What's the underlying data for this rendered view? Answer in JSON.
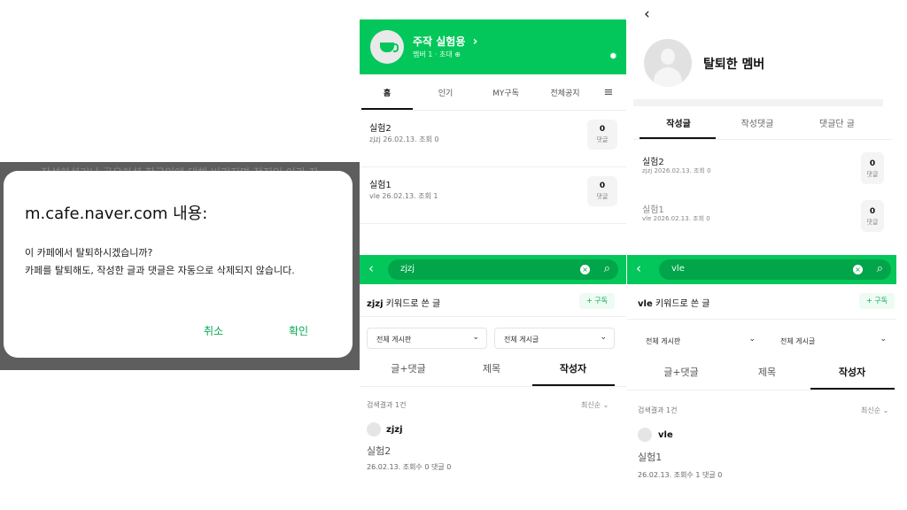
{
  "dialog": {
    "ghost_text": "작성하셨거나 공유하셨 한국인에 대해 버리지면 정진인 이라 자",
    "title": "m.cafe.naver.com 내용:",
    "line1": "이 카페에서 탈퇴하시겠습니까?",
    "line2": "카페를 탈퇴해도, 작성한 글과 댓글은 자동으로 삭제되지 않습니다.",
    "cancel": "취소",
    "confirm": "확인"
  },
  "cafe": {
    "name": "주작 실험용",
    "chevron": "›",
    "sub": "멤버 1 · 초대",
    "sub_icon": "⊕",
    "gear": "✹",
    "tabs": [
      "홈",
      "인기",
      "MY구독",
      "전체공지"
    ],
    "menu_icon": "≡",
    "posts": [
      {
        "title": "실험2",
        "meta": "zjzj  26.02.13.  조회 0",
        "count": "0",
        "label": "댓글"
      },
      {
        "title": "실험1",
        "meta": "vle  26.02.13.  조회 1",
        "count": "0",
        "label": "댓글"
      }
    ]
  },
  "search1": {
    "back": "‹",
    "query": "zjzj",
    "clear": "×",
    "search_icon": "⌕",
    "keyword": "zjzj",
    "keyword_suffix": " 키워드로 쓴 글",
    "subscribe": "+ 구독",
    "dropdown1": "전체 게시판",
    "dropdown2": "전체 게시글",
    "chev": "⌄",
    "tabs": [
      "글+댓글",
      "제목",
      "작성자"
    ],
    "result_count": "검색결과 1건",
    "sort": "최신순 ⌄",
    "author": "zjzj",
    "title": "실험2",
    "meta": "26.02.13.  조회수 0  댓글 0"
  },
  "search2": {
    "back": "‹",
    "query": "vle",
    "clear": "×",
    "search_icon": "⌕",
    "keyword": "vle",
    "keyword_suffix": " 키워드로 쓴 글",
    "subscribe": "+ 구독",
    "dropdown1": "전체 게시판",
    "dropdown2": "전체 게시글",
    "chev": "⌄",
    "tabs": [
      "글+댓글",
      "제목",
      "작성자"
    ],
    "result_count": "검색결과 1건",
    "sort": "최신순 ⌄",
    "author": "vle",
    "title": "실험1",
    "meta": "26.02.13.  조회수 1  댓글 0"
  },
  "member": {
    "back": "‹",
    "name": "탈퇴한 멤버",
    "tabs": [
      "작성글",
      "작성댓글",
      "댓글단 글"
    ],
    "posts": [
      {
        "title": "실험2",
        "meta": "zjzj  2026.02.13.  조회 0",
        "count": "0",
        "label": "댓글"
      },
      {
        "title": "실험1",
        "meta": "vle  2026.02.13.  조회 0",
        "count": "0",
        "label": "댓글"
      }
    ]
  }
}
